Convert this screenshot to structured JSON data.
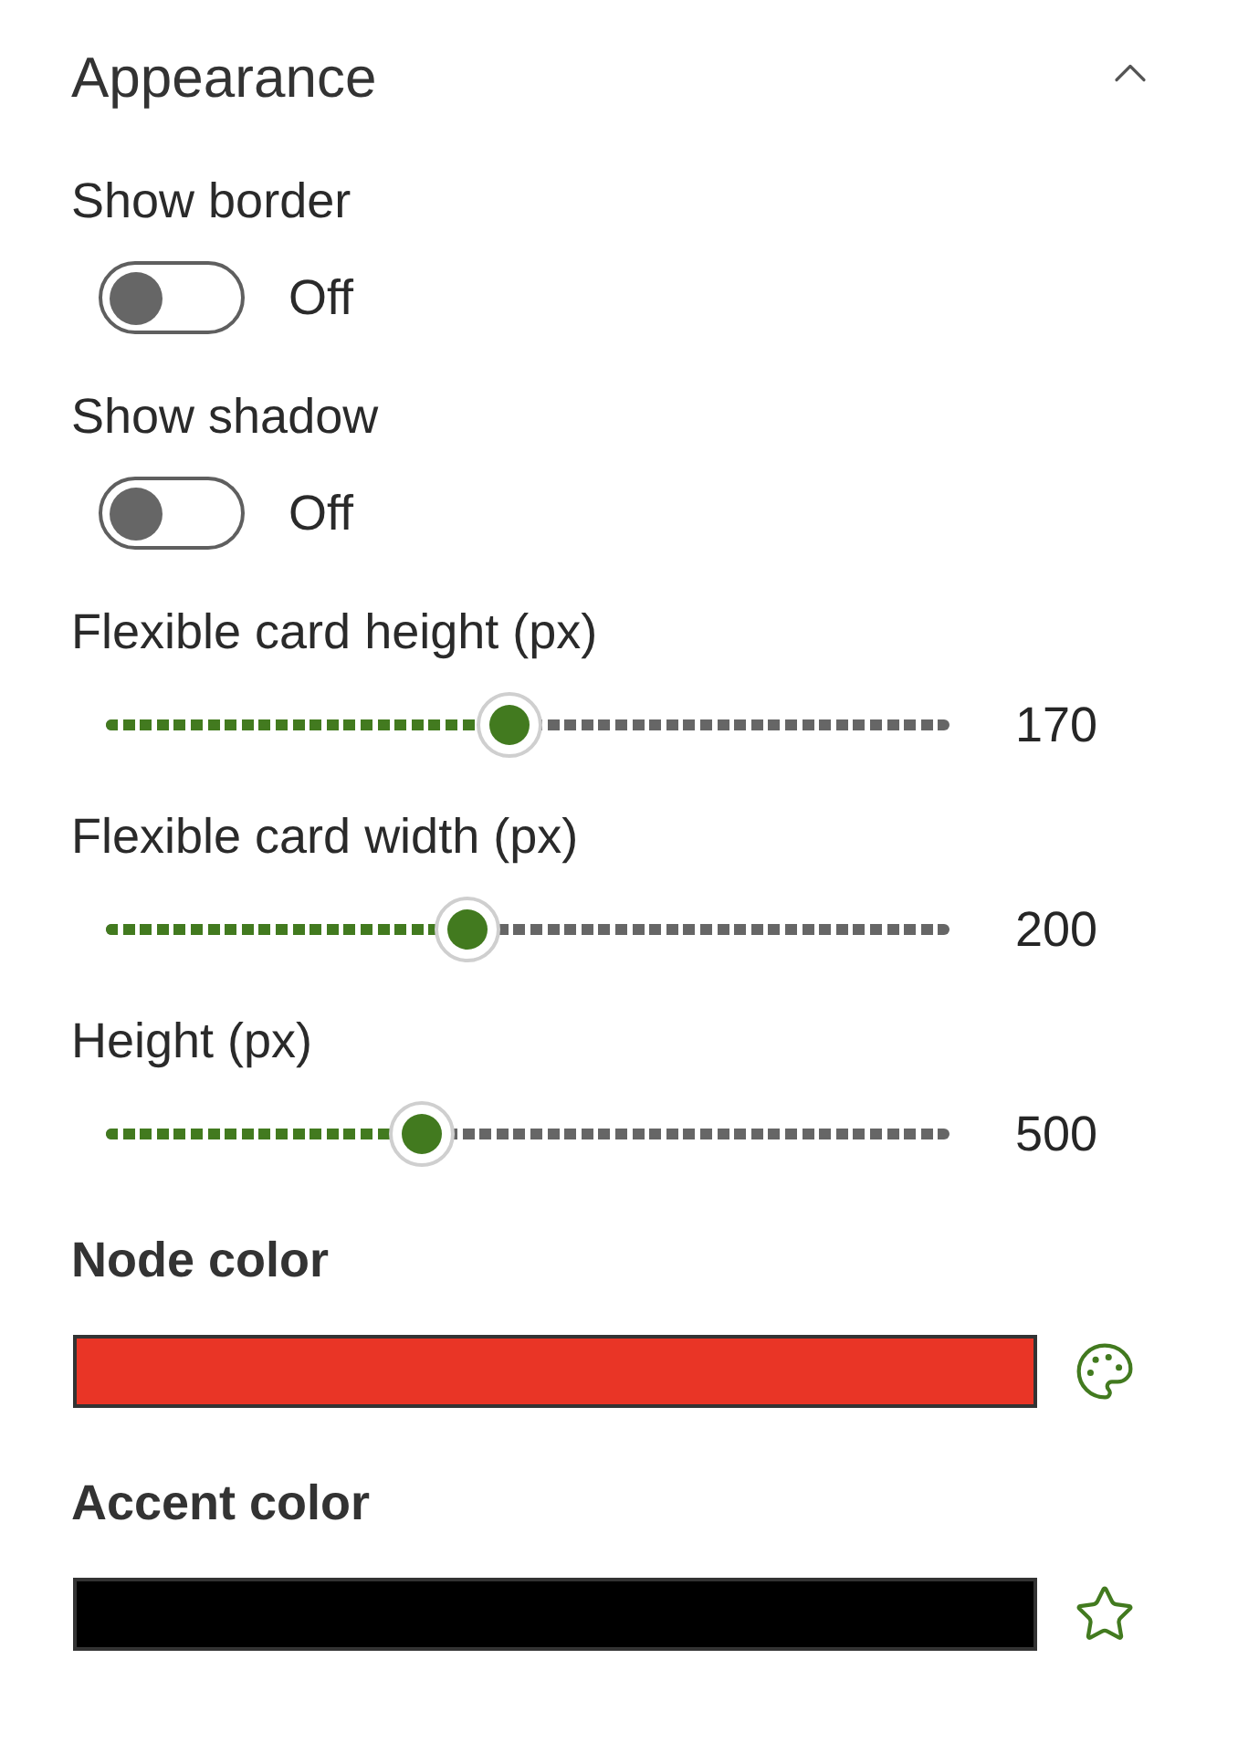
{
  "section": {
    "title": "Appearance",
    "expanded": true
  },
  "toggles": [
    {
      "label": "Show border",
      "on": false,
      "state_text": "Off"
    },
    {
      "label": "Show shadow",
      "on": false,
      "state_text": "Off"
    }
  ],
  "sliders": [
    {
      "label": "Flexible card height (px)",
      "level": 0.478,
      "value": "170"
    },
    {
      "label": "Flexible card width (px)",
      "level": 0.428,
      "value": "200"
    },
    {
      "label": "Height (px)",
      "level": 0.374,
      "value": "500"
    }
  ],
  "colors": [
    {
      "label": "Node color",
      "color": "#e93526",
      "kind": "palette"
    },
    {
      "label": "Accent color",
      "color": "#000000",
      "kind": "star"
    }
  ]
}
